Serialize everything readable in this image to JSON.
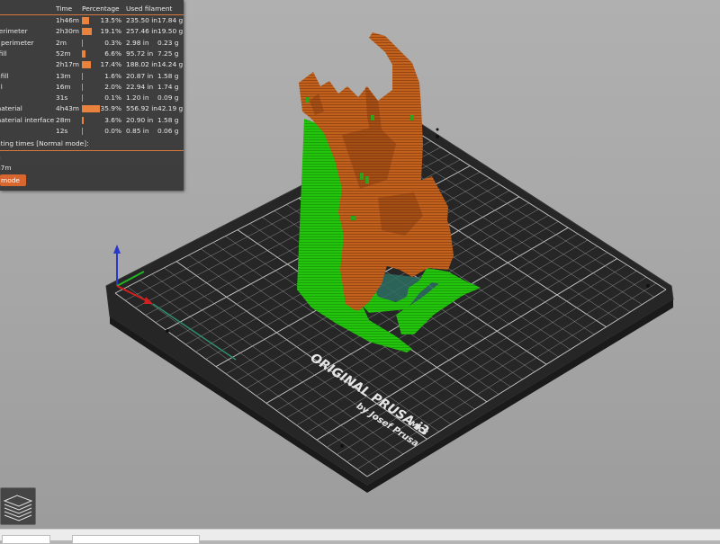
{
  "legend": {
    "headers": {
      "time": "Time",
      "percentage": "Percentage",
      "used_filament": "Used filament"
    },
    "rows": [
      {
        "name": "r",
        "time": "1h46m",
        "bar_pct": 13.5,
        "percentage": "13.5%",
        "length": "235.50 in",
        "weight": "17.84 g"
      },
      {
        "name": "perimeter",
        "time": "2h30m",
        "bar_pct": 19.1,
        "percentage": "19.1%",
        "length": "257.46 in",
        "weight": "19.50 g"
      },
      {
        "name": "g perimeter",
        "time": "2m",
        "bar_pct": 0.3,
        "percentage": "0.3%",
        "length": "2.98 in",
        "weight": "0.23 g"
      },
      {
        "name": "nfill",
        "time": "52m",
        "bar_pct": 6.6,
        "percentage": "6.6%",
        "length": "95.72 in",
        "weight": "7.25 g"
      },
      {
        "name": "l",
        "time": "2h17m",
        "bar_pct": 17.4,
        "percentage": "17.4%",
        "length": "188.02 in",
        "weight": "14.24 g"
      },
      {
        "name": "infill",
        "time": "13m",
        "bar_pct": 1.6,
        "percentage": "1.6%",
        "length": "20.87 in",
        "weight": "1.58 g"
      },
      {
        "name": "fill",
        "time": "16m",
        "bar_pct": 2.0,
        "percentage": "2.0%",
        "length": "22.94 in",
        "weight": "1.74 g"
      },
      {
        "name": "n",
        "time": "31s",
        "bar_pct": 0.1,
        "percentage": "0.1%",
        "length": "1.20 in",
        "weight": "0.09 g"
      },
      {
        "name": "material",
        "time": "4h43m",
        "bar_pct": 35.9,
        "percentage": "35.9%",
        "length": "556.92 in",
        "weight": "42.19 g"
      },
      {
        "name": "material interface",
        "time": "28m",
        "bar_pct": 3.6,
        "percentage": "3.6%",
        "length": "20.90 in",
        "weight": "1.58 g"
      },
      {
        "name": "",
        "time": "12s",
        "bar_pct": 0.0,
        "percentage": "0.0%",
        "length": "0.85 in",
        "weight": "0.06 g"
      }
    ],
    "printing_times_label": "nting times [Normal mode]:",
    "line_a": "n",
    "line_b": "h7m",
    "mode_button": "mode"
  },
  "bed": {
    "line1": "ORIGINAL PRUSA i3",
    "line1_suffix": "MK3",
    "line2": "by Josef Prusa"
  },
  "colors": {
    "accent": "#e8823c",
    "model_layers": "#c0611e",
    "support": "#22c40c",
    "bed_plate": "#262626",
    "grid": "#9a9a9a",
    "axis_x": "#d22020",
    "axis_y": "#22b422",
    "axis_z": "#2838c8"
  },
  "icons": {
    "layers_view": "layers-stack-icon"
  }
}
